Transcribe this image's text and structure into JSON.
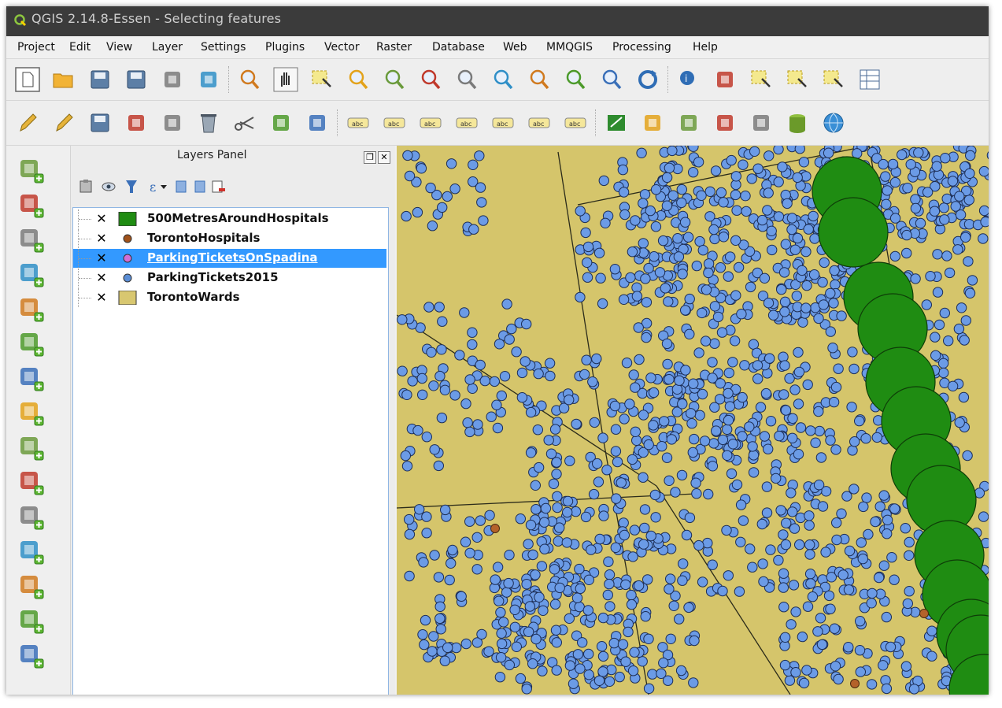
{
  "window": {
    "title": "QGIS 2.14.8-Essen - Selecting features"
  },
  "menu": [
    "Project",
    "Edit",
    "View",
    "Layer",
    "Settings",
    "Plugins",
    "Vector",
    "Raster",
    "Database",
    "Web",
    "MMQGIS",
    "Processing",
    "Help"
  ],
  "toolbar1": [
    "new-project-icon",
    "open-project-icon",
    "save-project-icon",
    "save-as-icon",
    "new-print-composer-icon",
    "composer-manager-icon",
    "touch-zoom-icon",
    "pan-map-icon",
    "pan-to-selection-icon",
    "zoom-in-icon",
    "zoom-out-icon",
    "zoom-native-icon",
    "zoom-full-icon",
    "zoom-to-selection-icon",
    "zoom-to-layer-icon",
    "zoom-last-icon",
    "zoom-next-icon",
    "refresh-icon",
    "identify-icon",
    "action-icon",
    "select-features-icon",
    "select-by-expression-icon",
    "deselect-icon",
    "attribute-table-icon"
  ],
  "toolbar2": [
    "current-edits-icon",
    "toggle-editing-icon",
    "save-edits-icon",
    "add-feature-icon",
    "node-tool-icon",
    "delete-selected-icon",
    "cut-features-icon",
    "copy-features-icon",
    "paste-features-icon",
    "label-icon",
    "label-highlight-icon",
    "pin-labels-icon",
    "show-hide-labels-icon",
    "move-label-icon",
    "rotate-label-icon",
    "change-label-icon",
    "georeferencer-icon",
    "h-tool-icon",
    "raster-tool-icon",
    "db-import-icon",
    "db-export-icon",
    "db-manager-icon",
    "globe-icon"
  ],
  "left_toolbar": [
    "add-vector-layer-icon",
    "add-raster-layer-icon",
    "add-postgis-layer-icon",
    "add-spatialite-layer-icon",
    "add-mssql-layer-icon",
    "add-oracle-layer-icon",
    "add-db2-layer-icon",
    "add-wms-layer-icon",
    "add-wcs-layer-icon",
    "add-wfs-layer-icon",
    "add-delimited-text-icon",
    "add-virtual-layer-icon",
    "new-vector-layer-icon",
    "add-wms-tile-icon",
    "georef-add-icon"
  ],
  "layers_panel": {
    "title": "Layers Panel",
    "layers": [
      {
        "name": "500MetresAroundHospitals",
        "checked": true,
        "symbol": "square",
        "color": "#1f8c12",
        "selected": false
      },
      {
        "name": "TorontoHospitals",
        "checked": true,
        "symbol": "circle",
        "color": "#a0521a",
        "selected": false
      },
      {
        "name": "ParkingTicketsOnSpadina",
        "checked": true,
        "symbol": "circle",
        "color": "#d36ed6",
        "selected": true
      },
      {
        "name": "ParkingTickets2015",
        "checked": true,
        "symbol": "circle",
        "color": "#5b8ed6",
        "selected": false
      },
      {
        "name": "TorontoWards",
        "checked": true,
        "symbol": "square",
        "color": "#d8c770",
        "selected": false
      }
    ]
  },
  "map_colors": {
    "ward_fill": "#d5c56b",
    "tickets": "#6b9be6",
    "buffers": "#1f8c12",
    "hospitals": "#b4622a"
  }
}
